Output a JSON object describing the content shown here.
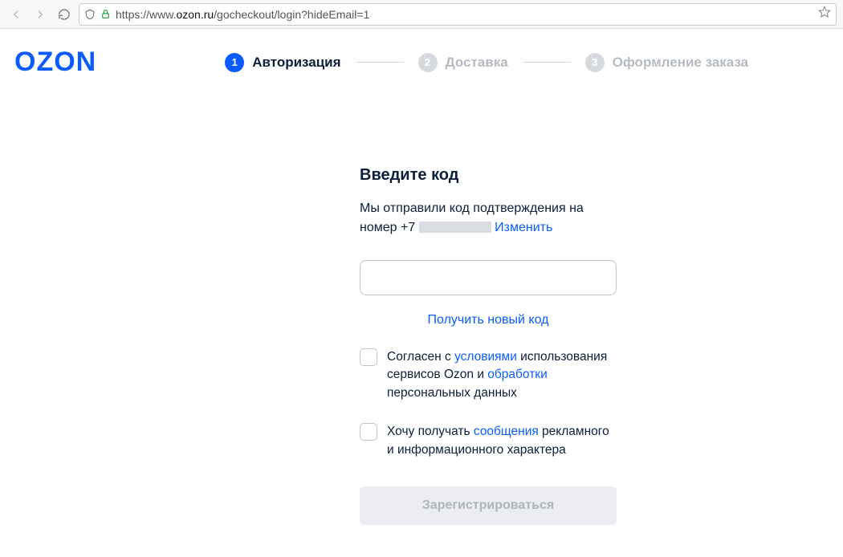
{
  "browser": {
    "url_prefix": "https://www.",
    "url_host": "ozon.ru",
    "url_path": "/gocheckout/login?hideEmail=1"
  },
  "logo": "OZON",
  "steps": [
    {
      "num": "1",
      "label": "Авторизация",
      "active": true
    },
    {
      "num": "2",
      "label": "Доставка",
      "active": false
    },
    {
      "num": "3",
      "label": "Оформление заказа",
      "active": false
    }
  ],
  "form": {
    "heading": "Введите код",
    "desc_line1": "Мы отправили код подтверждения на",
    "desc_prefix": "номер +7",
    "change_link": "Изменить",
    "resend_link": "Получить новый код",
    "agree_pre": "Согласен с ",
    "agree_link1": "условиями",
    "agree_mid": " использования сервисов Ozon и ",
    "agree_link2": "обработки",
    "agree_post": " персональных данных",
    "promo_pre": "Хочу получать ",
    "promo_link": "сообщения",
    "promo_post": " рекламного и информационного характера",
    "submit": "Зарегистрироваться"
  }
}
